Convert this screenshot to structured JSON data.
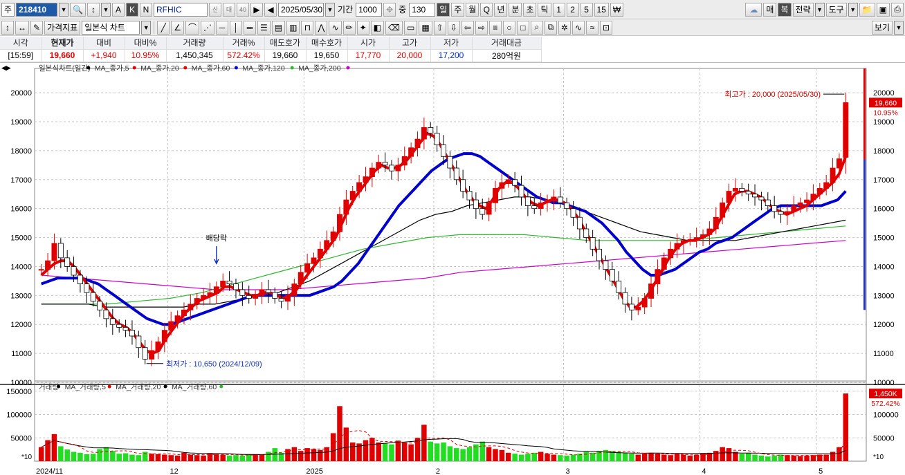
{
  "toolbar1": {
    "prefix": "주",
    "code": "218410",
    "name": "RFHIC",
    "name_badges": [
      "신",
      "대",
      "40"
    ],
    "modes": [
      "A",
      "K",
      "N"
    ],
    "date": "2025/05/30",
    "period_label": "기간",
    "period_value": "1000",
    "count_label": "중",
    "count_value": "130",
    "interval_buttons": [
      "일",
      "주",
      "월",
      "Q",
      "년",
      "분",
      "초",
      "틱",
      "1",
      "2",
      "5",
      "15",
      "₩"
    ],
    "right_buttons": [
      "매",
      "복",
      "전략",
      "도구"
    ]
  },
  "toolbar2": {
    "price_indicator": "가격지표",
    "chart_type": "일본식 차트",
    "view_button": "보기"
  },
  "quote": {
    "headers": [
      "시각",
      "현재가",
      "대비",
      "대비%",
      "거래량",
      "거래%",
      "매도호가",
      "매수호가",
      "시가",
      "고가",
      "저가",
      "거래대금"
    ],
    "values": [
      "[15:59]",
      "19,660",
      "+1,940",
      "10.95%",
      "1,450,345",
      "572.42%",
      "19,660",
      "19,650",
      "17,770",
      "20,000",
      "17,200",
      "280억원"
    ]
  },
  "chart_labels": {
    "legend_price": [
      {
        "text": "일본식차트(일간)",
        "color": "#000000"
      },
      {
        "text": "MA_종가,5",
        "color": "#e00000"
      },
      {
        "text": "MA_종가,20",
        "color": "#e00000"
      },
      {
        "text": "MA_종가,60",
        "color": "#0000cc"
      },
      {
        "text": "MA_종가,120",
        "color": "#2eb82e"
      },
      {
        "text": "MA_종가,200",
        "color": "#cc00cc"
      }
    ],
    "legend_volume": [
      {
        "text": "거래량",
        "color": "#000000"
      },
      {
        "text": "MA_거래량,5",
        "color": "#e00000"
      },
      {
        "text": "MA_거래량,20",
        "color": "#000000"
      },
      {
        "text": "MA_거래량,60",
        "color": "#2eb82e"
      }
    ],
    "high_annot": "최고가 : 20,000 (2025/05/30)",
    "low_annot": "최저가 : 10,650 (2024/12/09)",
    "dividend_annot": "배당락",
    "price_badge": "19,660",
    "price_pct": "10.95%",
    "vol_badge": "1,450K",
    "vol_pct": "572.42%",
    "vol_scale_unit": "*10"
  },
  "chart_data": [
    {
      "type": "candlestick",
      "title": "일본식차트(일간)",
      "ylim": [
        10000,
        20600
      ],
      "yticks": [
        10000,
        11000,
        12000,
        13000,
        14000,
        15000,
        16000,
        17000,
        18000,
        19000,
        20000
      ],
      "x_ticks": [
        "2024/11",
        "12",
        "2025",
        "2",
        "3",
        "4",
        "5"
      ],
      "last": {
        "open": 17770,
        "high": 20000,
        "low": 17200,
        "close": 19660
      },
      "highest": {
        "value": 20000,
        "date": "2025/05/30"
      },
      "lowest": {
        "value": 10650,
        "date": "2024/12/09"
      },
      "close": [
        13900,
        14200,
        14800,
        14300,
        14000,
        13700,
        13400,
        13100,
        12800,
        12500,
        12200,
        12000,
        11900,
        11800,
        11600,
        11200,
        10800,
        11100,
        11400,
        11800,
        12100,
        12300,
        12500,
        12700,
        12900,
        13000,
        13100,
        13300,
        13500,
        13400,
        13200,
        13000,
        12900,
        13000,
        13200,
        13100,
        12900,
        12800,
        13000,
        13400,
        13800,
        14100,
        14300,
        14600,
        14900,
        15200,
        15800,
        16300,
        16600,
        16900,
        17100,
        17400,
        17600,
        17500,
        17300,
        17500,
        17800,
        18100,
        18400,
        18800,
        18600,
        18200,
        17800,
        17400,
        17000,
        16600,
        16300,
        16000,
        15800,
        16200,
        16700,
        16900,
        17000,
        16800,
        16400,
        16100,
        16000,
        16200,
        16300,
        16400,
        16200,
        16000,
        15700,
        15300,
        15000,
        14600,
        14200,
        13900,
        13500,
        13100,
        12700,
        12500,
        12600,
        12900,
        13400,
        13900,
        14300,
        14600,
        14800,
        14900,
        14900,
        15000,
        15100,
        15300,
        15700,
        16200,
        16600,
        16700,
        16600,
        16500,
        16400,
        16300,
        16100,
        15900,
        15800,
        15900,
        16100,
        16200,
        16300,
        16500,
        16700,
        16900,
        17400,
        17720,
        19660
      ],
      "ma5": [
        13700,
        13900,
        14100,
        14200,
        14200,
        14000,
        13700,
        13400,
        13100,
        12800,
        12500,
        12200,
        12000,
        11900,
        11700,
        11400,
        11100,
        11000,
        11100,
        11500,
        11800,
        12100,
        12400,
        12600,
        12800,
        12900,
        13000,
        13100,
        13300,
        13300,
        13200,
        13100,
        13000,
        13000,
        13100,
        13100,
        13000,
        12900,
        13000,
        13200,
        13500,
        13800,
        14100,
        14400,
        14700,
        15000,
        15500,
        16000,
        16400,
        16700,
        17000,
        17300,
        17500,
        17400,
        17400,
        17500,
        17700,
        18000,
        18300,
        18600,
        18500,
        18200,
        17800,
        17400,
        17000,
        16600,
        16300,
        16100,
        16000,
        16300,
        16700,
        16900,
        16900,
        16700,
        16400,
        16200,
        16100,
        16200,
        16300,
        16300,
        16200,
        16000,
        15700,
        15300,
        14900,
        14500,
        14100,
        13700,
        13300,
        12900,
        12600,
        12600,
        12800,
        13100,
        13500,
        13900,
        14300,
        14600,
        14800,
        14900,
        14900,
        15000,
        15100,
        15300,
        15700,
        16100,
        16500,
        16600,
        16600,
        16500,
        16400,
        16200,
        16000,
        15900,
        15800,
        15900,
        16000,
        16100,
        16300,
        16500,
        16700,
        16900,
        17200,
        17800
      ],
      "ma20": [
        13400,
        13500,
        13600,
        13600,
        13600,
        13600,
        13500,
        13400,
        13200,
        13000,
        12800,
        12600,
        12400,
        12200,
        12100,
        12000,
        12000,
        12100,
        12200,
        12300,
        12400,
        12500,
        12600,
        12700,
        12800,
        12900,
        13000,
        13000,
        13000,
        13000,
        13000,
        13000,
        13000,
        13000,
        13100,
        13200,
        13300,
        13500,
        13800,
        14100,
        14500,
        14900,
        15300,
        15700,
        16100,
        16400,
        16700,
        17000,
        17300,
        17500,
        17700,
        17800,
        17900,
        17900,
        17800,
        17600,
        17400,
        17200,
        17000,
        16800,
        16600,
        16400,
        16300,
        16200,
        16200,
        16100,
        16000,
        15900,
        15700,
        15500,
        15200,
        14900,
        14500,
        14200,
        13900,
        13700,
        13700,
        13800,
        13900,
        14100,
        14300,
        14500,
        14600,
        14800,
        14900,
        15000,
        15200,
        15400,
        15600,
        15800,
        16000,
        16100,
        16100,
        16100,
        16100,
        16100,
        16100,
        16200,
        16300,
        16600
      ],
      "ma60": [
        12700,
        12700,
        12700,
        12700,
        12600,
        12600,
        12600,
        12600,
        12600,
        12600,
        12700,
        12700,
        12800,
        12900,
        13000,
        13100,
        13300,
        13500,
        13800,
        14100,
        14400,
        14700,
        15000,
        15300,
        15600,
        15800,
        15900,
        16100,
        16200,
        16300,
        16400,
        16400,
        16300,
        16200,
        16000,
        15800,
        15600,
        15400,
        15200,
        15100,
        15000,
        14900,
        14900,
        14900,
        14900,
        15000,
        15100,
        15200,
        15300,
        15400,
        15500,
        15600
      ],
      "ma120": [
        12700,
        12700,
        12700,
        12800,
        12900,
        13100,
        13400,
        13700,
        14000,
        14300,
        14600,
        14800,
        15000,
        15100,
        15100,
        15100,
        15000,
        14900,
        14900,
        14900,
        14900,
        15000,
        15100,
        15200,
        15300,
        15400
      ],
      "ma200": [
        13700,
        13600,
        13500,
        13400,
        13300,
        13200,
        13200,
        13200,
        13300,
        13400,
        13500,
        13600,
        13800,
        13900,
        14000,
        14100,
        14200,
        14300,
        14400,
        14500,
        14600,
        14700,
        14800,
        14900
      ]
    },
    {
      "type": "bar",
      "title": "거래량",
      "ylim": [
        0,
        160000
      ],
      "yticks": [
        50000,
        100000,
        150000
      ],
      "unit": "*10",
      "last_volume": 1450345,
      "values": [
        30000,
        45000,
        58000,
        32000,
        25000,
        20000,
        18000,
        15000,
        16000,
        26000,
        30000,
        22000,
        16000,
        17000,
        14000,
        13000,
        20000,
        16000,
        15000,
        14000,
        13000,
        12000,
        18000,
        14000,
        13000,
        12000,
        16000,
        15000,
        14000,
        12000,
        13000,
        12000,
        14000,
        15000,
        14000,
        20000,
        28000,
        18000,
        26000,
        30000,
        22000,
        28000,
        26000,
        24000,
        30000,
        60000,
        118000,
        72000,
        40000,
        38000,
        45000,
        50000,
        40000,
        38000,
        36000,
        44000,
        40000,
        36000,
        50000,
        78000,
        42000,
        38000,
        40000,
        32000,
        28000,
        26000,
        30000,
        36000,
        42000,
        30000,
        26000,
        24000,
        18000,
        16000,
        14000,
        16000,
        18000,
        20000,
        16000,
        14000,
        13000,
        12000,
        14000,
        16000,
        20000,
        18000,
        22000,
        24000,
        22000,
        20000,
        18000,
        16000,
        14000,
        16000,
        18000,
        16000,
        14000,
        13000,
        16000,
        14000,
        12000,
        14000,
        16000,
        18000,
        22000,
        30000,
        28000,
        20000,
        16000,
        18000,
        14000,
        12000,
        10000,
        12000,
        14000,
        13000,
        12000,
        11000,
        12000,
        13000,
        14000,
        14000,
        20000,
        30000,
        145000
      ]
    }
  ]
}
